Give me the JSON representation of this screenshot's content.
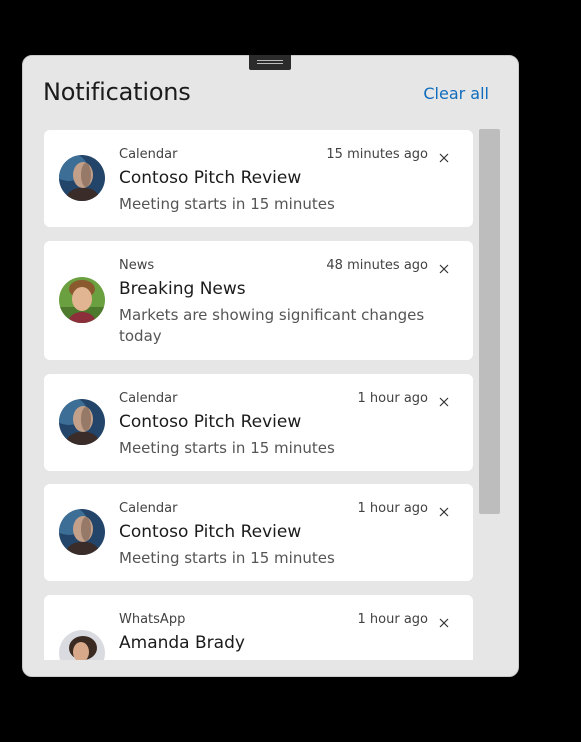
{
  "panel": {
    "title": "Notifications",
    "clear_all_label": "Clear all"
  },
  "notifications": [
    {
      "source": "Calendar",
      "time": "15 minutes ago",
      "title": "Contoso Pitch Review",
      "body": "Meeting starts in 15 minutes",
      "avatar": "man-portrait"
    },
    {
      "source": "News",
      "time": "48 minutes ago",
      "title": "Breaking News",
      "body": "Markets are showing significant changes today",
      "avatar": "boy-portrait"
    },
    {
      "source": "Calendar",
      "time": "1 hour ago",
      "title": "Contoso Pitch Review",
      "body": "Meeting starts in 15 minutes",
      "avatar": "man-portrait"
    },
    {
      "source": "Calendar",
      "time": "1 hour ago",
      "title": "Contoso Pitch Review",
      "body": "Meeting starts in 15 minutes",
      "avatar": "man-portrait"
    },
    {
      "source": "WhatsApp",
      "time": "1 hour ago",
      "title": "Amanda Brady",
      "body": "",
      "avatar": "woman-portrait"
    }
  ],
  "colors": {
    "accent": "#0f6cbd",
    "panel_bg": "#e6e6e6",
    "card_bg": "#ffffff"
  }
}
